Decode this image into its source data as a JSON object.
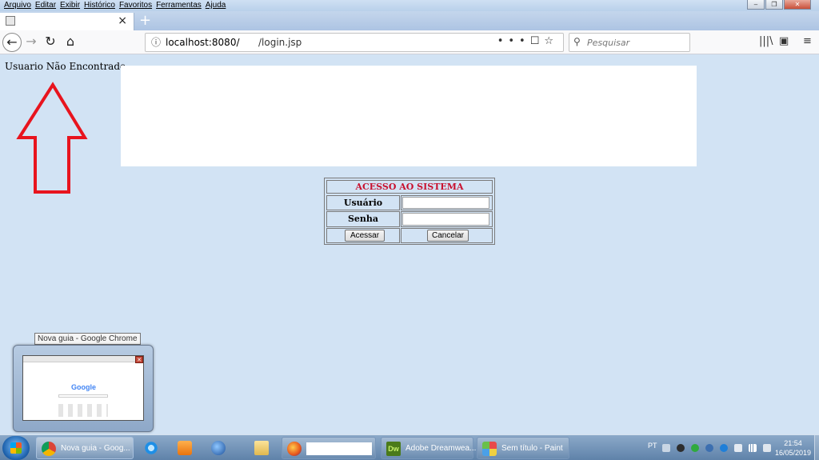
{
  "menubar": {
    "items": [
      "Arquivo",
      "Editar",
      "Exibir",
      "Histórico",
      "Favoritos",
      "Ferramentas",
      "Ajuda"
    ]
  },
  "tab": {
    "title": "",
    "close_glyph": "×"
  },
  "newtab_glyph": "+",
  "nav": {
    "url": "localhost:8080/",
    "url_path": "/login.jsp",
    "search_placeholder": "Pesquisar"
  },
  "page": {
    "error_message": "Usuario Não Encontrado",
    "annotation_color": "#e8141e"
  },
  "login": {
    "title": "ACESSO AO SISTEMA",
    "user_label": "Usuário",
    "password_label": "Senha",
    "user_value": "",
    "password_value": "",
    "submit_label": "Acessar",
    "cancel_label": "Cancelar"
  },
  "thumbnail": {
    "tooltip": "Nova guia - Google Chrome",
    "preview_text": "Google"
  },
  "taskbar": {
    "items": [
      {
        "label": "Nova guia - Goog...",
        "icon": "chrome-icon"
      },
      {
        "label": "",
        "icon": "ie-icon"
      },
      {
        "label": "",
        "icon": "media-player-icon"
      },
      {
        "label": "",
        "icon": "thunderbird-icon"
      },
      {
        "label": "",
        "icon": "explorer-icon"
      },
      {
        "label": "",
        "icon": "firefox-icon"
      },
      {
        "label": "Adobe Dreamwea...",
        "icon": "dreamweaver-icon"
      },
      {
        "label": "Sem título - Paint",
        "icon": "paint-icon"
      }
    ],
    "language": "PT",
    "time": "21:54",
    "date": "16/05/2019"
  }
}
